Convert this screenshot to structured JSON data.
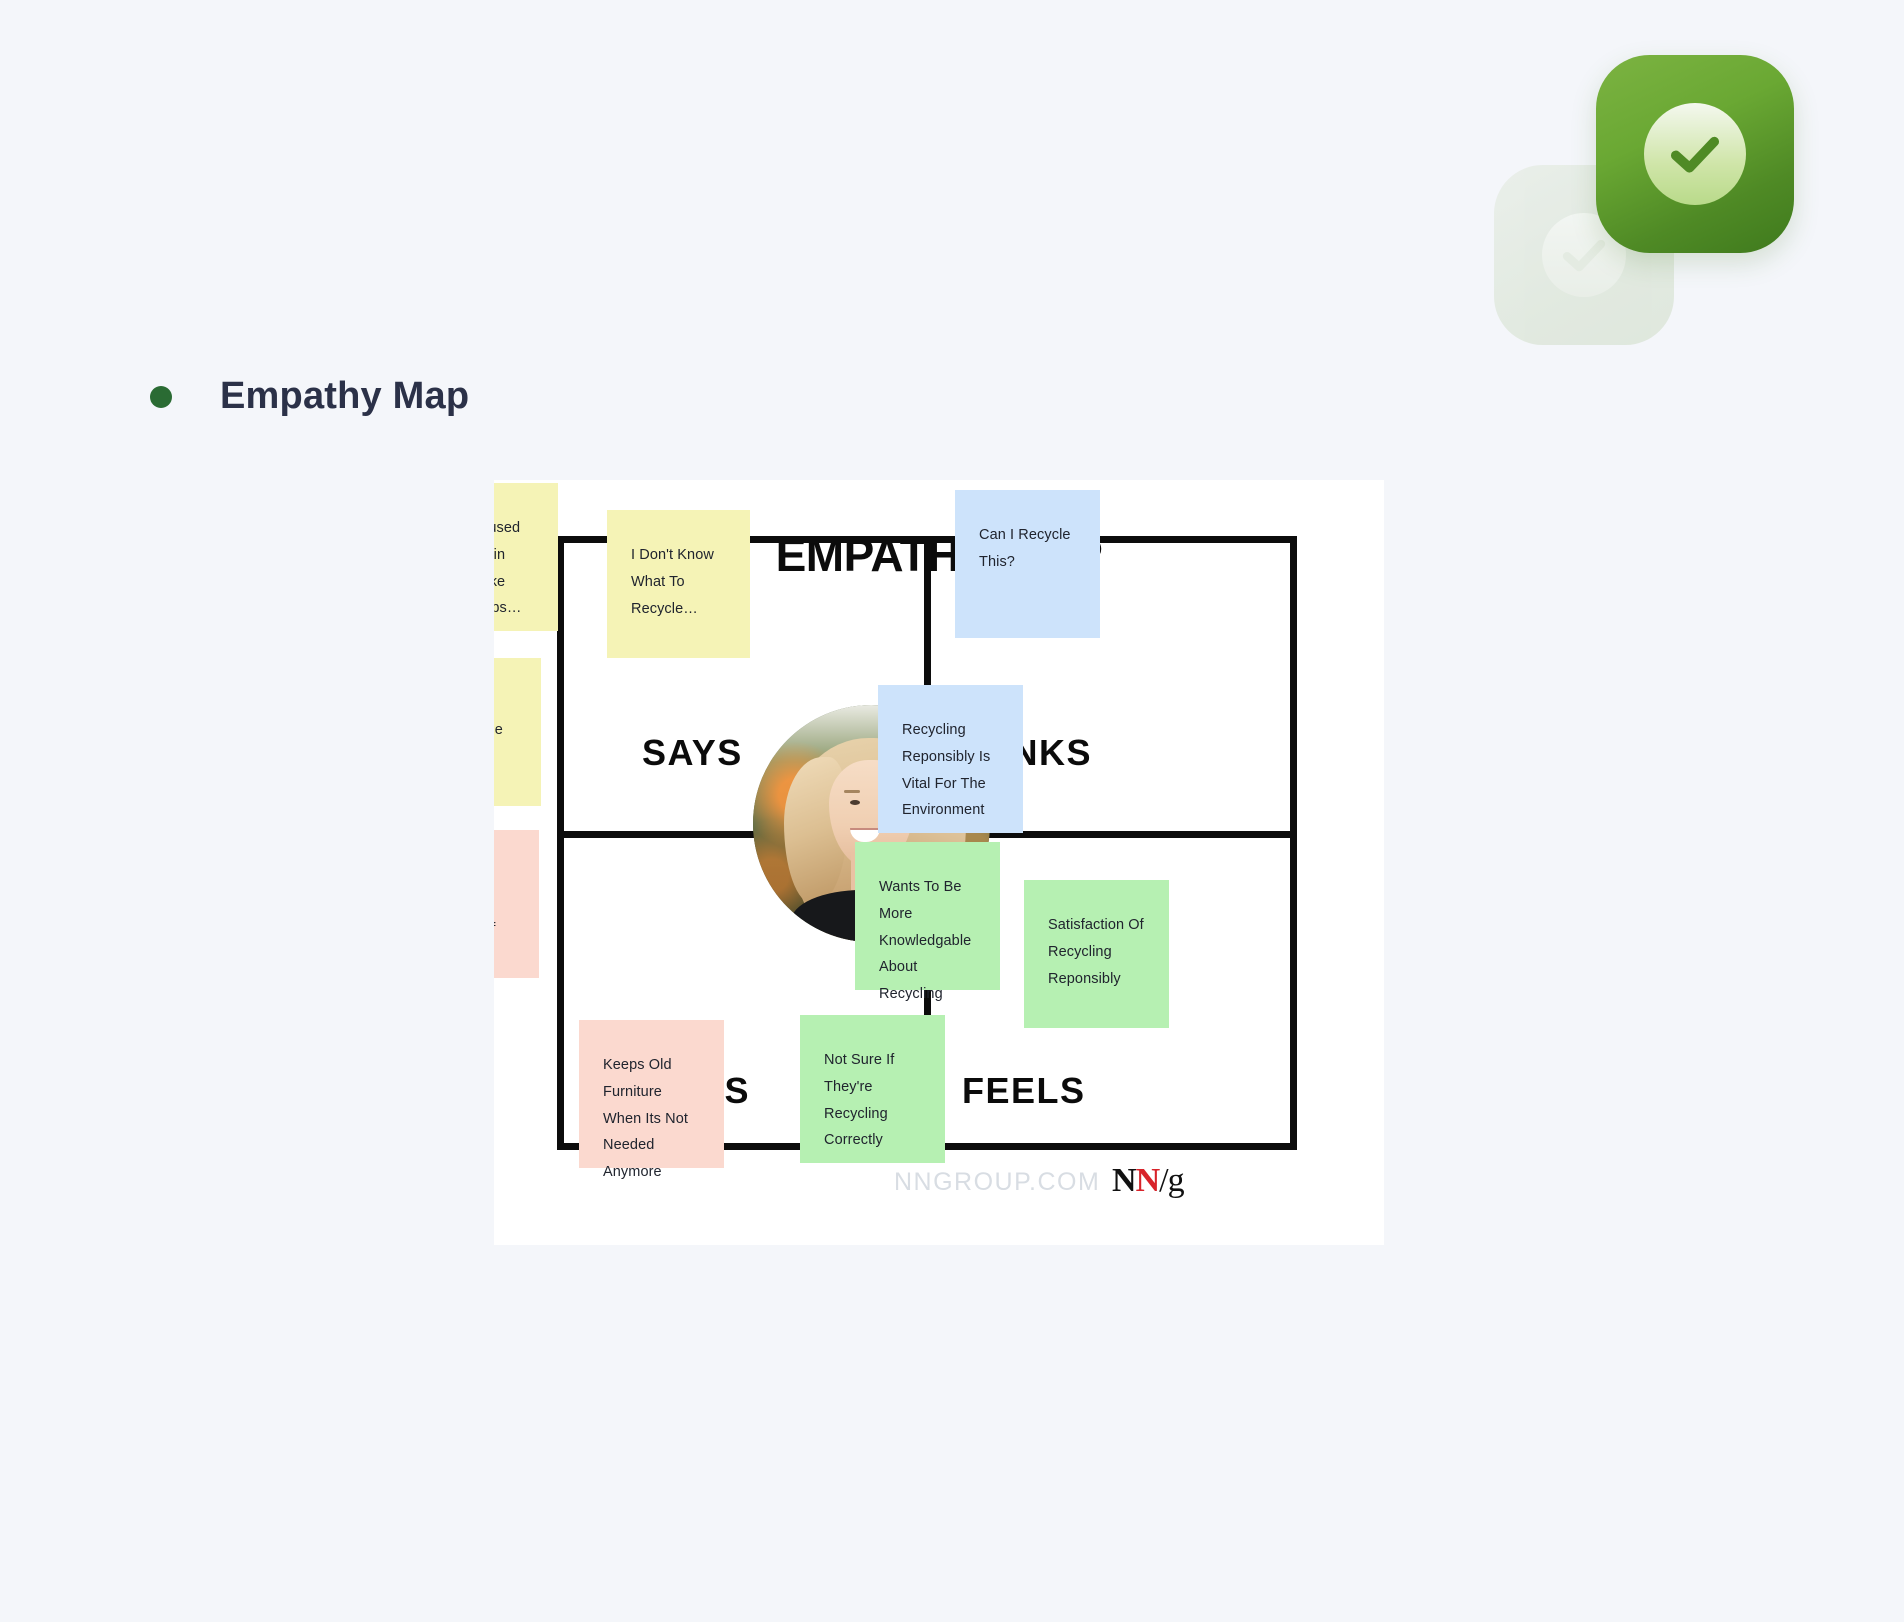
{
  "logo": {
    "front_icon": "check-circle-icon",
    "back_icon": "check-circle-icon-faded",
    "accent_green": "#6aa833",
    "check_color": "#4f8a25"
  },
  "header": {
    "bullet_color": "#2a6b33",
    "title": "Empathy Map"
  },
  "map": {
    "title": "EMPATHY MAP",
    "quadrants": [
      {
        "key": "says",
        "label": "SAYS"
      },
      {
        "key": "thinks",
        "label": "THINKS"
      },
      {
        "key": "does",
        "label": "DOES"
      },
      {
        "key": "feels",
        "label": "FEELS"
      }
    ],
    "persona_photo_alt": "persona-portrait",
    "notes": [
      {
        "id": "note-says-1",
        "quadrant": "says",
        "color": "#f5f3b6",
        "color_name": "yellow",
        "text": "I'm Confused On Certain Items, Like Light Bulbs…"
      },
      {
        "id": "note-says-2",
        "quadrant": "says",
        "color": "#f5f3b6",
        "color_name": "yellow",
        "text": "I Don't Know What To Recycle…"
      },
      {
        "id": "note-says-3",
        "quadrant": "says",
        "color": "#f5f3b6",
        "color_name": "yellow",
        "text": "Recycling Shouldn't Be That Hard"
      },
      {
        "id": "note-thinks-1",
        "quadrant": "thinks",
        "color": "#cde3fb",
        "color_name": "blue",
        "text": "Can I Recycle This?"
      },
      {
        "id": "note-thinks-2",
        "quadrant": "thinks",
        "color": "#cde3fb",
        "color_name": "blue",
        "text": "Recycling Reponsibly Is Vital For The Environment"
      },
      {
        "id": "note-does-1",
        "quadrant": "does",
        "color": "#fbd9cf",
        "color_name": "pink",
        "text": "Tries To Recycle To The Best Of Their Knowledge"
      },
      {
        "id": "note-does-2",
        "quadrant": "does",
        "color": "#fbd9cf",
        "color_name": "pink",
        "text": "Keeps Old Furniture When Its Not Needed Anymore"
      },
      {
        "id": "note-feels-1",
        "quadrant": "feels",
        "color": "#b6f0b2",
        "color_name": "green",
        "text": "Wants To Be More Knowledgable About Recycling"
      },
      {
        "id": "note-feels-2",
        "quadrant": "feels",
        "color": "#b6f0b2",
        "color_name": "green",
        "text": "Satisfaction Of Recycling Reponsibly"
      },
      {
        "id": "note-feels-3",
        "quadrant": "feels",
        "color": "#b6f0b2",
        "color_name": "green",
        "text": "Not Sure If They're Recycling Correctly"
      }
    ],
    "watermark": "NNGROUP.COM",
    "brand": {
      "n1": "N",
      "n2": "N",
      "slash": "/",
      "g": "g"
    }
  }
}
